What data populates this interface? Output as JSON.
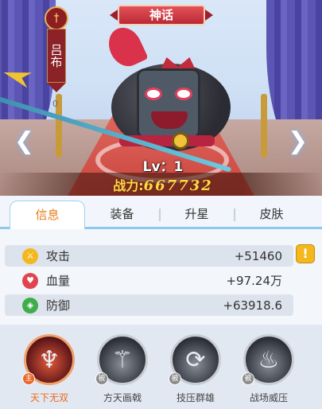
{
  "hero": {
    "rarity_banner": "神话",
    "name": "吕布",
    "emblem_icon": "sword-emblem-icon",
    "flag_counter": "0",
    "level": "Lv：1",
    "power_label": "战力:",
    "power_value": "667732"
  },
  "nav": {
    "prev_icon": "chevron-left-icon",
    "next_icon": "chevron-right-icon"
  },
  "tabs": [
    {
      "label": "信息",
      "active": true
    },
    {
      "label": "装备",
      "active": false
    },
    {
      "label": "升星",
      "active": false
    },
    {
      "label": "皮肤",
      "active": false
    }
  ],
  "stats": [
    {
      "label": "攻击",
      "value": "+51460",
      "icon": "sword-icon",
      "color": "#f3b81e"
    },
    {
      "label": "血量",
      "value": "+97.24万",
      "icon": "heart-icon",
      "color": "#e0454f"
    },
    {
      "label": "防御",
      "value": "+63918.6",
      "icon": "shield-icon",
      "color": "#3fae4a"
    }
  ],
  "tip_button": "!",
  "skills": [
    {
      "label": "天下无双",
      "badge": "主",
      "active": true,
      "icon": "demon-rage-icon"
    },
    {
      "label": "方天画戟",
      "badge": "被",
      "active": false,
      "icon": "halberd-icon"
    },
    {
      "label": "技压群雄",
      "badge": "被",
      "active": false,
      "icon": "whirlwind-icon"
    },
    {
      "label": "战场威压",
      "badge": "被",
      "active": false,
      "icon": "flame-aura-icon"
    }
  ],
  "colors": {
    "accent": "#e87b18",
    "tab_border": "#8fc8ef",
    "power": "#ffd84a"
  }
}
